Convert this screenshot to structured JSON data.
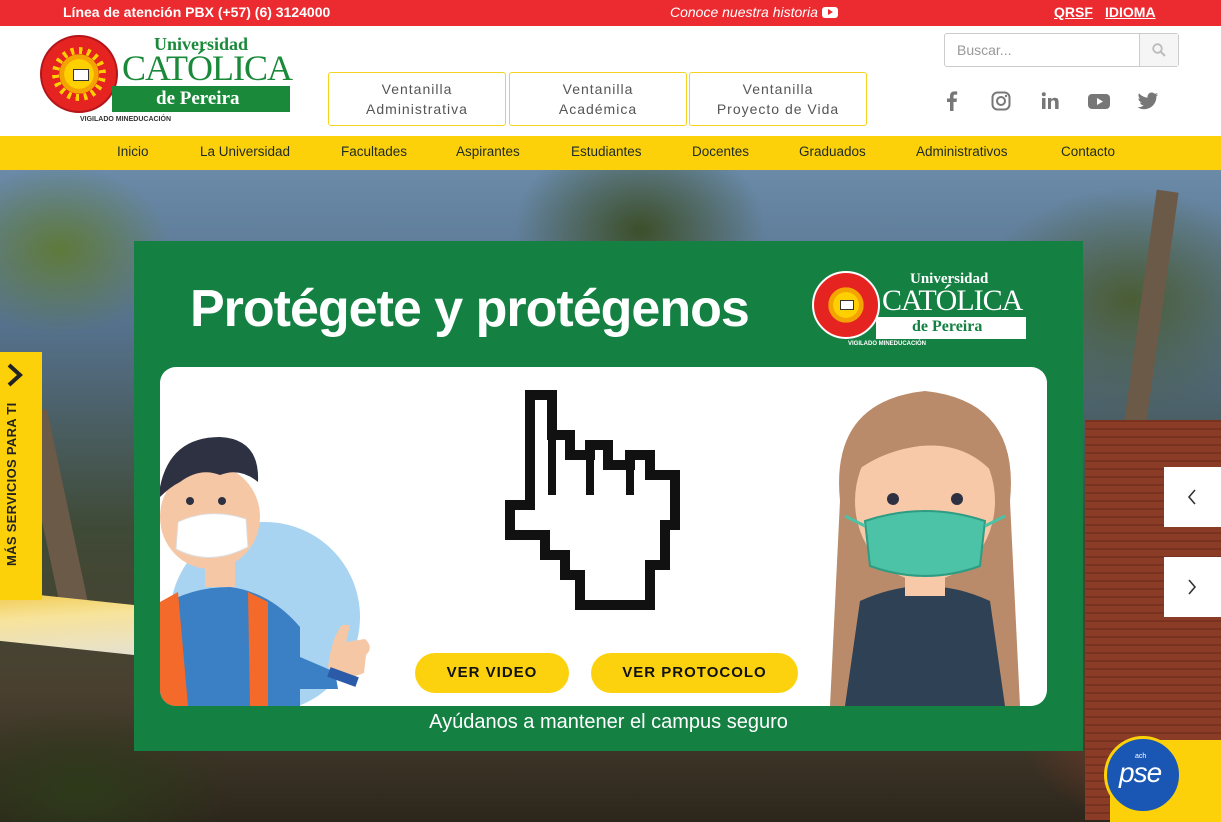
{
  "topbar": {
    "phone": "Línea de atención PBX (+57) (6) 3124000",
    "history": "Conoce nuestra historia",
    "qrsf": "QRSF",
    "idioma": "IDIOMA"
  },
  "logo": {
    "line1": "Universidad",
    "line2": "CATÓLICA",
    "line3": "de Pereira",
    "line4": "VIGILADO MINEDUCACIÓN"
  },
  "ventanillas": [
    {
      "line1": "Ventanilla",
      "line2": "Administrativa"
    },
    {
      "line1": "Ventanilla",
      "line2": "Académica"
    },
    {
      "line1": "Ventanilla",
      "line2": "Proyecto de Vida"
    }
  ],
  "search": {
    "placeholder": "Buscar..."
  },
  "social_icons": [
    "facebook-icon",
    "instagram-icon",
    "linkedin-icon",
    "youtube-icon",
    "twitter-icon"
  ],
  "nav": {
    "items": [
      "Inicio",
      "La Universidad",
      "Facultades",
      "Aspirantes",
      "Estudiantes",
      "Docentes",
      "Graduados",
      "Administrativos",
      "Contacto"
    ]
  },
  "banner": {
    "title": "Protégete y protégenos",
    "logo_line1": "Universidad",
    "logo_line2": "CATÓLICA",
    "logo_line3": "de Pereira",
    "logo_line4": "VIGILADO MINEDUCACIÓN",
    "btn_video": "VER VIDEO",
    "btn_protocolo": "VER PROTOCOLO",
    "tagline": "Ayúdanos a mantener el campus seguro"
  },
  "side_tab": {
    "label": "MÁS SERVICIOS PARA TI"
  },
  "pse": {
    "label": "pse",
    "small": "ach"
  },
  "colors": {
    "topbar_red": "#ec2b30",
    "brand_green": "#148143",
    "nav_yellow": "#fcd10a",
    "button_yellow": "#fcd20f"
  }
}
